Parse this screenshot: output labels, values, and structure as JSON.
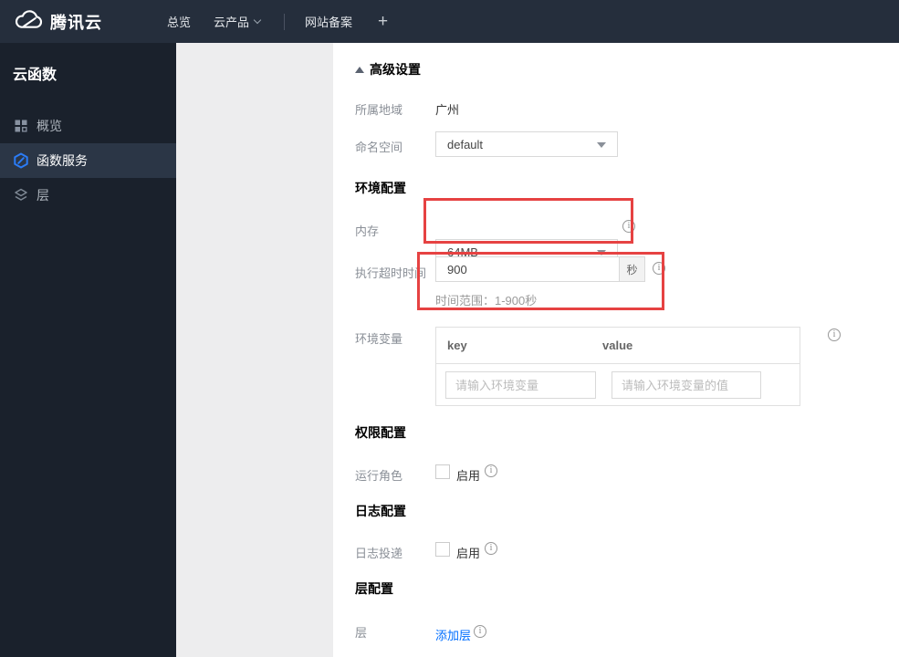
{
  "topbar": {
    "brand": "腾讯云",
    "items": [
      {
        "label": "总览"
      },
      {
        "label": "云产品"
      },
      {
        "label": "网站备案"
      }
    ],
    "plus_label": "+"
  },
  "sidebar": {
    "title": "云函数",
    "items": [
      {
        "label": "概览",
        "icon": "overview-grid-icon",
        "selected": false
      },
      {
        "label": "函数服务",
        "icon": "function-service-icon",
        "selected": true
      },
      {
        "label": "层",
        "icon": "layers-icon",
        "selected": false
      }
    ]
  },
  "content": {
    "advanced_toggle": {
      "label": "高级设置",
      "state": "expanded"
    },
    "region_row": {
      "label": "所属地域",
      "value": "广州"
    },
    "namespace_row": {
      "label": "命名空间",
      "value": "default"
    },
    "env_section_title": "环境配置",
    "memory_row": {
      "label": "内存",
      "value": "64MB"
    },
    "timeout_row": {
      "label": "执行超时时间",
      "value": "900",
      "unit": "秒",
      "hint": "时间范围：1-900秒"
    },
    "env_vars_row": {
      "label": "环境变量",
      "key_header": "key",
      "value_header": "value",
      "key_placeholder": "请输入环境变量",
      "value_placeholder": "请输入环境变量的值"
    },
    "perm_section_title": "权限配置",
    "role_row": {
      "label": "运行角色",
      "checkbox_label": "启用",
      "checked": false
    },
    "log_section_title": "日志配置",
    "logship_row": {
      "label": "日志投递",
      "checkbox_label": "启用",
      "checked": false
    },
    "layer_section_title": "层配置",
    "layer_row": {
      "label": "层",
      "link_label": "添加层"
    }
  },
  "colors": {
    "topbar_bg": "#252e3c",
    "sidebar_bg": "#1a212c",
    "sidebar_selected_bg": "#2b3646",
    "panel_bg": "#ededee",
    "accent_blue": "#006eff",
    "highlight_red": "#e64242",
    "icon_blue": "#2b7cf6"
  }
}
